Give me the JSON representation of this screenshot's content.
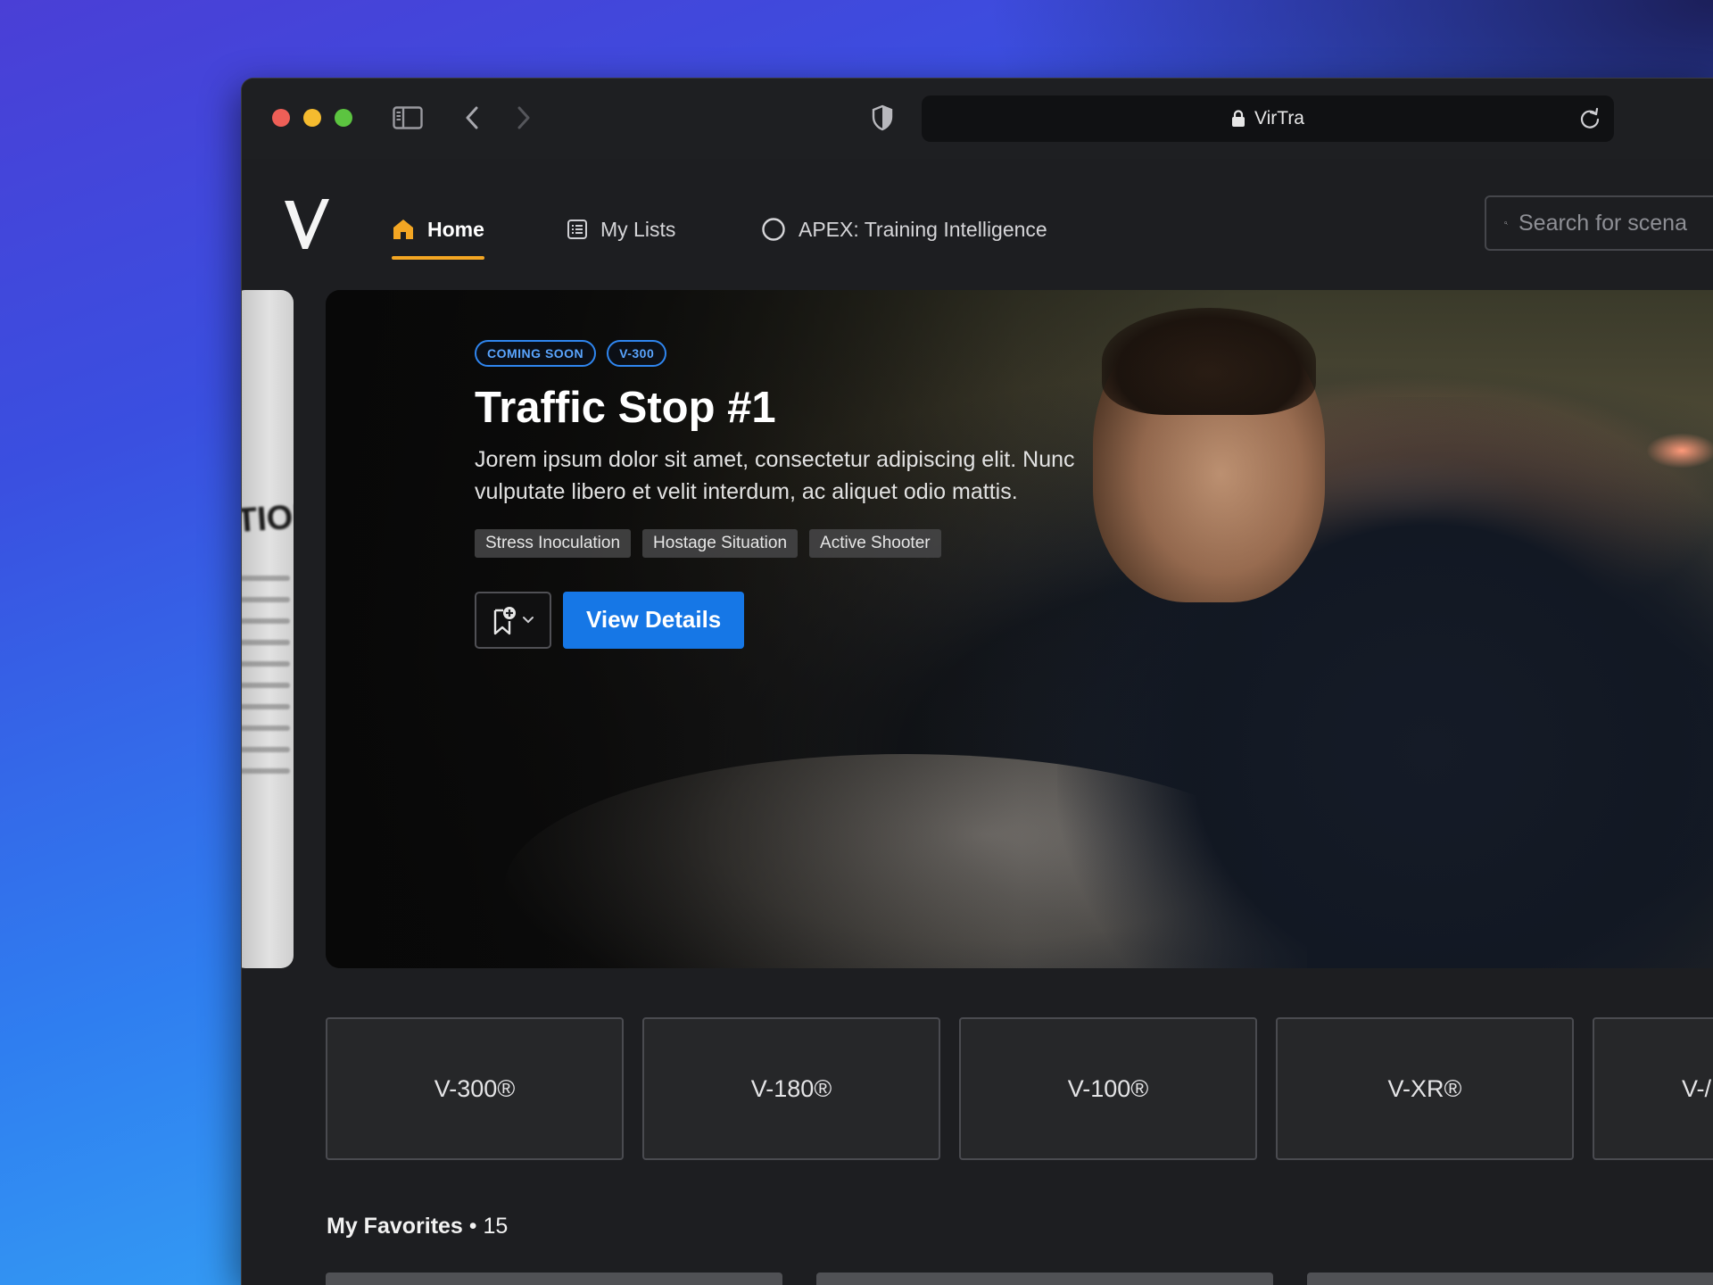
{
  "browser": {
    "url_label": "VirTra"
  },
  "nav": {
    "items": [
      {
        "label": "Home",
        "active": true
      },
      {
        "label": "My Lists"
      },
      {
        "label": "APEX: Training Intelligence"
      }
    ],
    "search_placeholder": "Search for scena",
    "accent_color": "#f3a623"
  },
  "hero": {
    "badges": [
      "COMING SOON",
      "V-300"
    ],
    "title": "Traffic Stop #1",
    "description": "Jorem ipsum dolor sit amet, consectetur adipiscing elit. Nunc vulputate libero et velit interdum, ac aliquet odio mattis.",
    "tags": [
      "Stress Inoculation",
      "Hostage Situation",
      "Active Shooter"
    ],
    "primary_action": "View Details",
    "primary_color": "#1677e6",
    "prev_slide_text": "TION"
  },
  "platforms": [
    "V-300®",
    "V-180®",
    "V-100®",
    "V-XR®",
    "V-/"
  ],
  "favorites": {
    "title": "My Favorites",
    "separator": " • ",
    "count": "15"
  }
}
